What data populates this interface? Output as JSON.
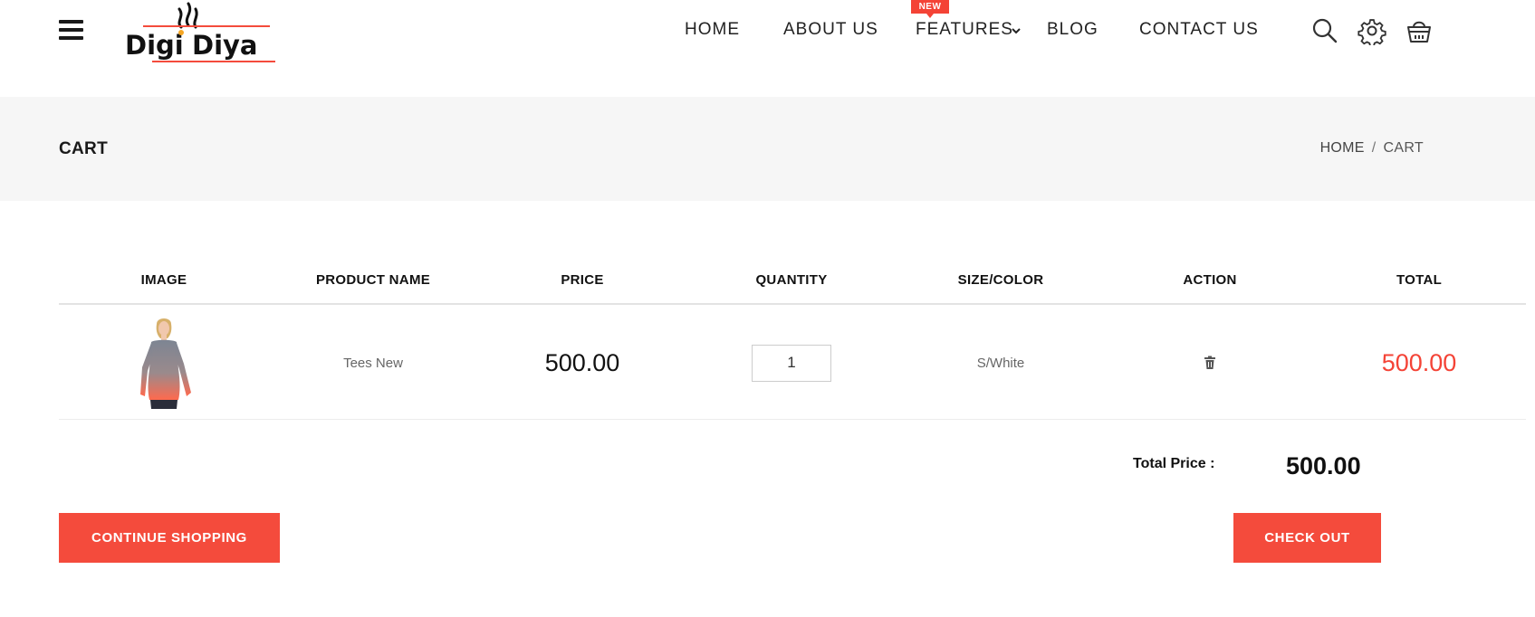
{
  "header": {
    "logo_text": "DigiDiya",
    "nav": [
      {
        "label": "HOME"
      },
      {
        "label": "ABOUT US"
      },
      {
        "label": "FEATURES",
        "badge": "NEW"
      },
      {
        "label": "BLOG"
      },
      {
        "label": "CONTACT US"
      }
    ],
    "icons": [
      "search-icon",
      "gear-icon",
      "basket-icon"
    ]
  },
  "page": {
    "title": "CART",
    "breadcrumb": {
      "home": "HOME",
      "separator": "/",
      "current": "CART"
    }
  },
  "table": {
    "headers": [
      "IMAGE",
      "PRODUCT NAME",
      "PRICE",
      "QUANTITY",
      "SIZE/COLOR",
      "ACTION",
      "TOTAL"
    ],
    "rows": [
      {
        "product_name": "Tees New",
        "price": "500.00",
        "quantity": "1",
        "size_color": "S/White",
        "total": "500.00"
      }
    ]
  },
  "summary": {
    "total_label": "Total Price :",
    "total_value": "500.00"
  },
  "buttons": {
    "continue": "CONTINUE SHOPPING",
    "checkout": "CHECK OUT"
  },
  "colors": {
    "accent": "#f44b3c",
    "total_text": "#f44336",
    "bar_background": "#f6f6f6"
  }
}
